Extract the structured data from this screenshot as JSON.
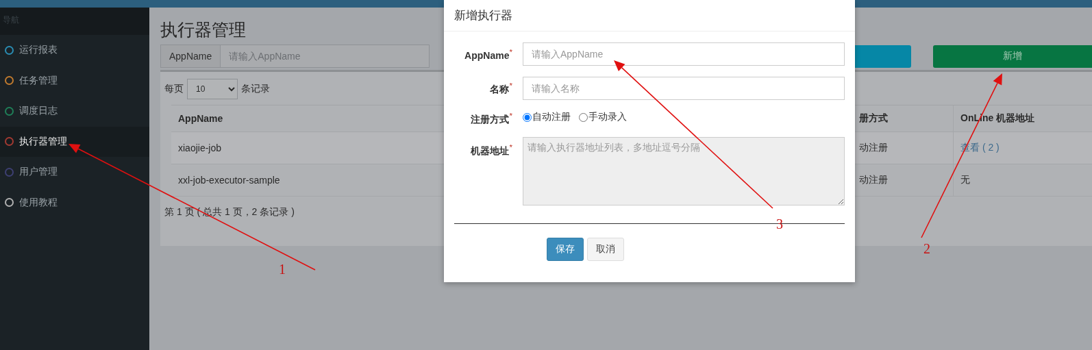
{
  "sidebar": {
    "header": "导航",
    "items": [
      {
        "label": "运行报表",
        "color": "#2a8db3",
        "selected": false
      },
      {
        "label": "任务管理",
        "color": "#c07a2e",
        "selected": false
      },
      {
        "label": "调度日志",
        "color": "#1f7f58",
        "selected": false
      },
      {
        "label": "执行器管理",
        "color": "#a23a32",
        "selected": true
      },
      {
        "label": "用户管理",
        "color": "#3d3f72",
        "selected": false
      },
      {
        "label": "使用教程",
        "color": "#b0b0b0",
        "selected": false
      }
    ]
  },
  "page_title": "执行器管理",
  "search": {
    "addon": "AppName",
    "placeholder": "请输入AppName"
  },
  "add_button": "新增",
  "page_size": {
    "prefix": "每页",
    "value": "10",
    "suffix": "条记录"
  },
  "table": {
    "columns": [
      "AppName",
      "册方式",
      "OnLine 机器地址"
    ],
    "rows": [
      [
        {
          "text": "xiaojie-job",
          "kind": "text"
        },
        {
          "text": "动注册",
          "kind": "text"
        },
        {
          "text": "查看 ( 2 )",
          "kind": "link"
        }
      ],
      [
        {
          "text": "xxl-job-executor-sample",
          "kind": "text"
        },
        {
          "text": "动注册",
          "kind": "text"
        },
        {
          "text": "无",
          "kind": "text"
        }
      ]
    ]
  },
  "pagination": "第 1 页 ( 总共 1 页，2 条记录 )",
  "modal": {
    "title": "新增执行器",
    "fields": [
      {
        "kind": "input",
        "label": "AppName",
        "required_mark": "*",
        "placeholder": "请输入AppName"
      },
      {
        "kind": "input",
        "label": "名称",
        "required_mark": "*",
        "placeholder": "请输入名称"
      },
      {
        "kind": "radio",
        "label": "注册方式",
        "required_mark": "*",
        "options": [
          {
            "label": "自动注册",
            "selected": true
          },
          {
            "label": "手动录入",
            "selected": false
          }
        ]
      },
      {
        "kind": "textarea",
        "label": "机器地址",
        "required_mark": "*",
        "placeholder": "请输入执行器地址列表，多地址逗号分隔",
        "disabled": true
      }
    ],
    "buttons": [
      {
        "label": "保存",
        "kind": "primary"
      },
      {
        "label": "取消",
        "kind": "default"
      }
    ]
  },
  "annotations": [
    {
      "label": "1"
    },
    {
      "label": "2"
    },
    {
      "label": "3"
    }
  ]
}
